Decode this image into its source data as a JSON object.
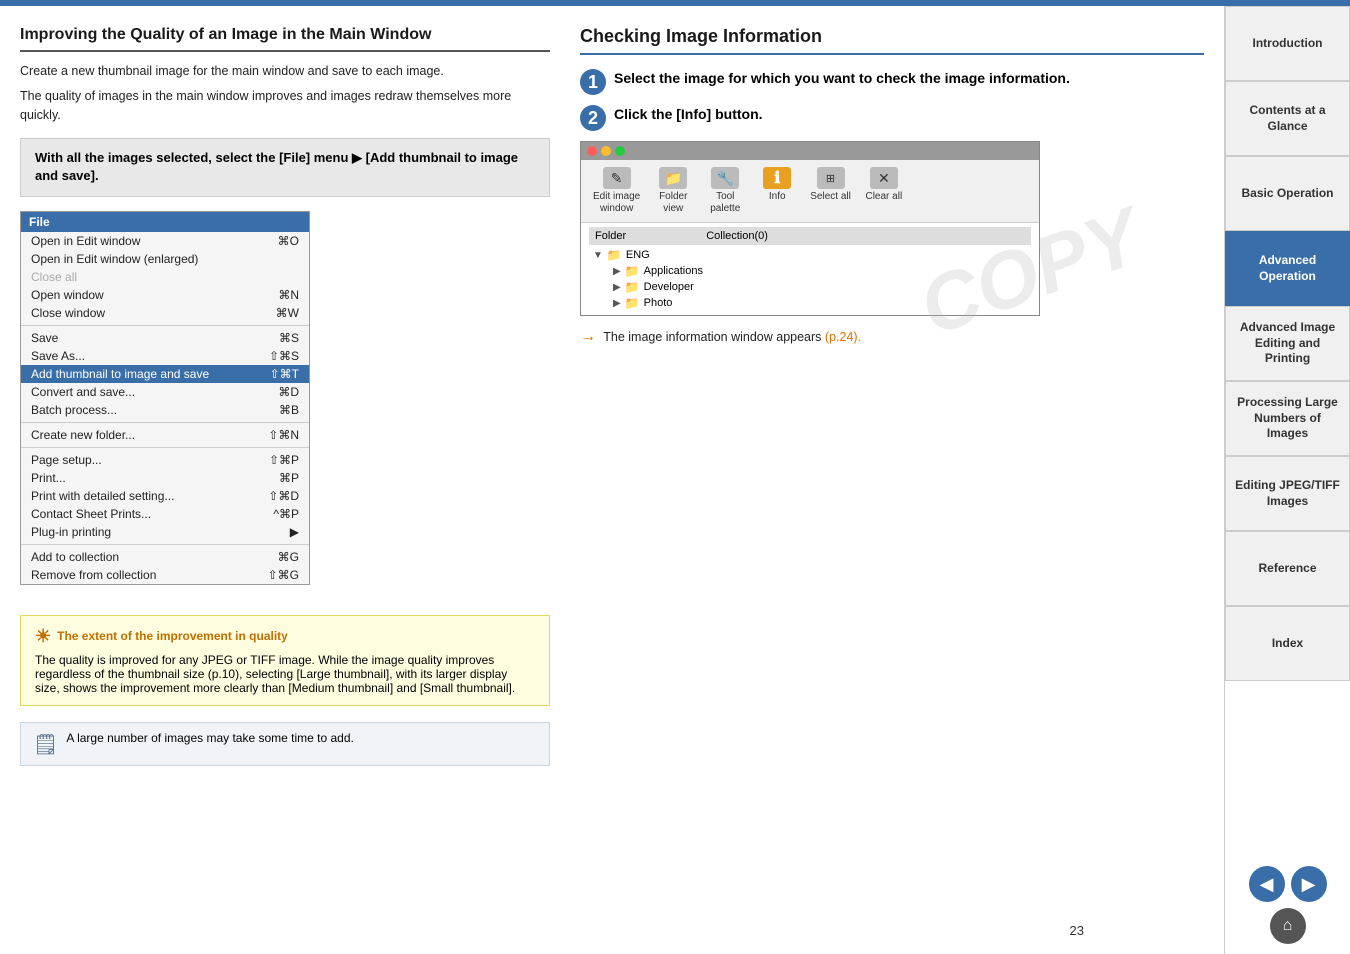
{
  "top_bar": {},
  "left_section": {
    "title": "Improving the Quality of an Image in the Main Window",
    "body1": "Create a new thumbnail image for the main window and save to each image.",
    "body2": "The quality of images in the main window improves and images redraw themselves more quickly.",
    "instruction": "With all the images selected, select the [File] menu ▶ [Add thumbnail to image and save].",
    "file_menu": {
      "header": "File",
      "items": [
        {
          "label": "Open in Edit window",
          "shortcut": "⌘O",
          "disabled": false,
          "highlighted": false
        },
        {
          "label": "Open in Edit window (enlarged)",
          "shortcut": "",
          "disabled": false,
          "highlighted": false
        },
        {
          "label": "Close all",
          "shortcut": "",
          "disabled": true,
          "highlighted": false
        },
        {
          "label": "Open window",
          "shortcut": "⌘N",
          "disabled": false,
          "highlighted": false
        },
        {
          "label": "Close window",
          "shortcut": "⌘W",
          "disabled": false,
          "highlighted": false
        },
        {
          "separator": true
        },
        {
          "label": "Save",
          "shortcut": "⌘S",
          "disabled": false,
          "highlighted": false
        },
        {
          "label": "Save As...",
          "shortcut": "⇧⌘S",
          "disabled": false,
          "highlighted": false
        },
        {
          "label": "Add thumbnail to image and save",
          "shortcut": "⇧⌘T",
          "disabled": false,
          "highlighted": true
        },
        {
          "label": "Convert and save...",
          "shortcut": "⌘D",
          "disabled": false,
          "highlighted": false
        },
        {
          "label": "Batch process...",
          "shortcut": "⌘B",
          "disabled": false,
          "highlighted": false
        },
        {
          "separator": true
        },
        {
          "label": "Create new folder...",
          "shortcut": "⇧⌘N",
          "disabled": false,
          "highlighted": false
        },
        {
          "separator": true
        },
        {
          "label": "Page setup...",
          "shortcut": "⇧⌘P",
          "disabled": false,
          "highlighted": false
        },
        {
          "label": "Print...",
          "shortcut": "⌘P",
          "disabled": false,
          "highlighted": false
        },
        {
          "label": "Print with detailed setting...",
          "shortcut": "⇧⌘D",
          "disabled": false,
          "highlighted": false
        },
        {
          "label": "Contact Sheet Prints...",
          "shortcut": "^⌘P",
          "disabled": false,
          "highlighted": false
        },
        {
          "label": "Plug-in printing",
          "shortcut": "▶",
          "disabled": false,
          "highlighted": false
        },
        {
          "separator": true
        },
        {
          "label": "Add to collection",
          "shortcut": "⌘G",
          "disabled": false,
          "highlighted": false
        },
        {
          "label": "Remove from collection",
          "shortcut": "⇧⌘G",
          "disabled": false,
          "highlighted": false
        }
      ]
    },
    "tip": {
      "title": "The extent of the improvement in quality",
      "body": "The quality is improved for any JPEG or TIFF image. While the image quality improves regardless of the thumbnail size (p.10), selecting [Large thumbnail], with its larger display size, shows the improvement more clearly than [Medium thumbnail] and [Small thumbnail]."
    },
    "note": "A large number of images may take some time to add."
  },
  "right_section": {
    "title": "Checking Image Information",
    "step1": {
      "number": "1",
      "text": "Select the image for which you want to check the image information."
    },
    "step2": {
      "number": "2",
      "text": "Click the [Info] button."
    },
    "toolbar": {
      "buttons": [
        {
          "label": "Edit image\nwindow",
          "icon": "✎"
        },
        {
          "label": "Folder\nview",
          "icon": "📁"
        },
        {
          "label": "Tool\npalette",
          "icon": "🔧"
        },
        {
          "label": "Info",
          "icon": "ℹ",
          "special": true
        },
        {
          "label": "Select all",
          "icon": "⊞"
        },
        {
          "label": "Clear all",
          "icon": "✕"
        }
      ],
      "tree": {
        "header_left": "Folder",
        "header_right": "Collection(0)",
        "items": [
          {
            "label": "ENG",
            "level": 0,
            "type": "folder"
          },
          {
            "label": "Applications",
            "level": 1,
            "type": "folder"
          },
          {
            "label": "Developer",
            "level": 1,
            "type": "folder"
          },
          {
            "label": "Photo",
            "level": 1,
            "type": "folder"
          }
        ]
      }
    },
    "result_text": "The image information window appears",
    "result_link": "(p.24).",
    "copy_watermark": "COPY"
  },
  "sidebar": {
    "tabs": [
      {
        "label": "Introduction",
        "active": false,
        "highlight": false
      },
      {
        "label": "Contents at a Glance",
        "active": false,
        "highlight": false
      },
      {
        "label": "Basic Operation",
        "active": false,
        "highlight": false
      },
      {
        "label": "Advanced Operation",
        "active": true,
        "highlight": false
      },
      {
        "label": "Advanced Image Editing and Printing",
        "active": false,
        "highlight": false
      },
      {
        "label": "Processing Large Numbers of Images",
        "active": false,
        "highlight": false
      },
      {
        "label": "Editing JPEG/TIFF Images",
        "active": false,
        "highlight": false
      },
      {
        "label": "Reference",
        "active": false,
        "highlight": false
      },
      {
        "label": "Index",
        "active": false,
        "highlight": false
      }
    ],
    "nav": {
      "prev_label": "◀",
      "next_label": "▶",
      "home_label": "⌂"
    }
  },
  "page_number": "23"
}
